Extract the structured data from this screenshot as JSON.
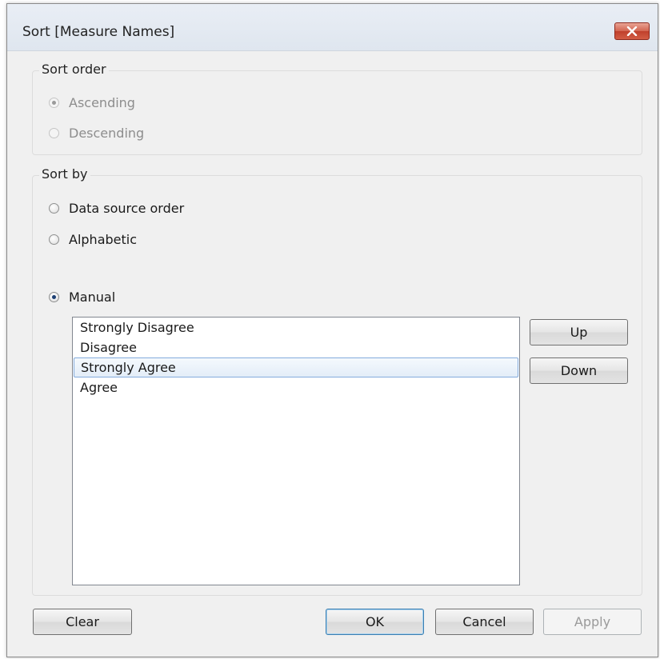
{
  "window": {
    "title": "Sort [Measure Names]"
  },
  "sort_order": {
    "label": "Sort order",
    "options": [
      {
        "label": "Ascending",
        "checked": true,
        "enabled": false
      },
      {
        "label": "Descending",
        "checked": false,
        "enabled": false
      }
    ]
  },
  "sort_by": {
    "label": "Sort by",
    "options": [
      {
        "label": "Data source order",
        "checked": false
      },
      {
        "label": "Alphabetic",
        "checked": false
      },
      {
        "label": "Manual",
        "checked": true
      }
    ],
    "manual_list": [
      "Strongly Disagree",
      "Disagree",
      "Strongly Agree",
      "Agree"
    ],
    "selected_item": "Strongly Agree",
    "up_label": "Up",
    "down_label": "Down"
  },
  "footer": {
    "clear_label": "Clear",
    "ok_label": "OK",
    "cancel_label": "Cancel",
    "apply_label": "Apply"
  },
  "icons": {
    "close": "close-icon"
  },
  "colors": {
    "close_button": "#d35d45",
    "selection_border": "#84acdd",
    "default_button_border": "#3c7fb1"
  }
}
